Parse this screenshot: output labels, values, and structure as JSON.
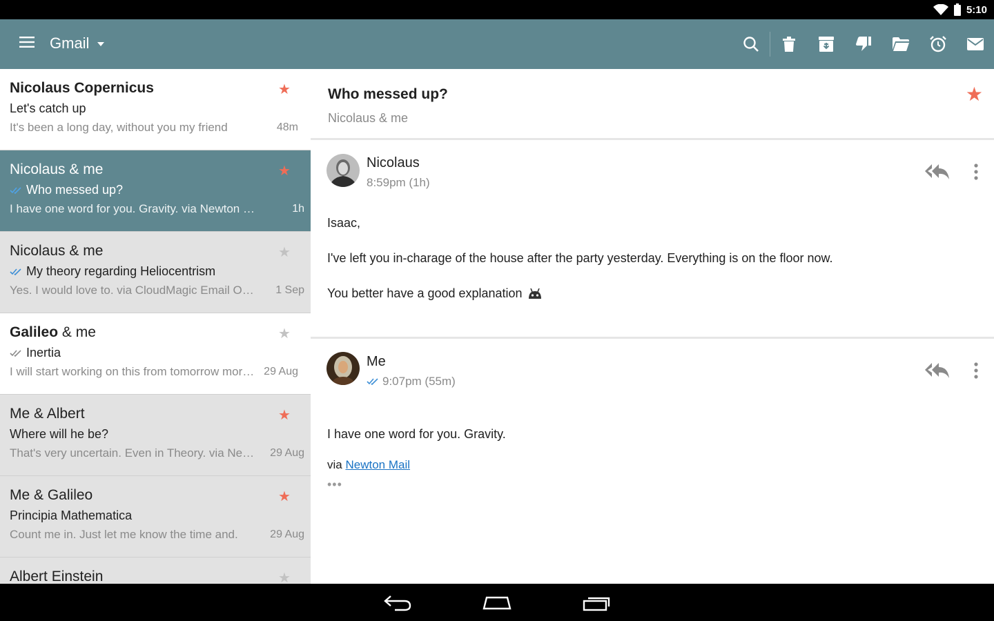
{
  "status_bar": {
    "time": "5:10"
  },
  "app_bar": {
    "account": "Gmail",
    "actions": [
      "search-icon",
      "trash-icon",
      "archive-icon",
      "spam-icon",
      "move-to-folder-icon",
      "snooze-icon",
      "mark-unread-icon"
    ]
  },
  "threads": [
    {
      "sender_bold": "Nicolaus Copernicus",
      "sender_rest": "",
      "subject": "Let's catch up",
      "preview": "It's been a long day, without you my friend",
      "time": "48m",
      "starred": true,
      "state": "unread",
      "check": "none"
    },
    {
      "sender_bold": "",
      "sender_rest": "Nicolaus & me",
      "subject": "Who messed up?",
      "preview": "I have one word for you. Gravity. via Newton Mail",
      "time": "1h",
      "starred": true,
      "state": "selected",
      "check": "blue"
    },
    {
      "sender_bold": "",
      "sender_rest": "Nicolaus & me",
      "subject": "My theory regarding Heliocentrism",
      "preview": "Yes. I would love to. via CloudMagic Email On...",
      "time": "1 Sep",
      "starred": false,
      "state": "read",
      "check": "blue"
    },
    {
      "sender_bold": "Galileo",
      "sender_rest": " & me",
      "subject": "Inertia",
      "preview": "I will start working on this from tomorrow morning",
      "time": "29 Aug",
      "starred": false,
      "state": "unread",
      "check": "grey"
    },
    {
      "sender_bold": "",
      "sender_rest": "Me & Albert",
      "subject": "Where will he be?",
      "preview": "That's very uncertain. Even in Theory. via Newton",
      "time": "29 Aug",
      "starred": true,
      "state": "read",
      "check": "none"
    },
    {
      "sender_bold": "",
      "sender_rest": "Me & Galileo",
      "subject": "Principia Mathematica",
      "preview": "Count me in. Just let me know the time and.",
      "time": "29 Aug",
      "starred": true,
      "state": "read",
      "check": "none"
    },
    {
      "sender_bold": "",
      "sender_rest": "Albert Einstein",
      "subject": "",
      "preview": "",
      "time": "",
      "starred": false,
      "state": "read",
      "check": "none"
    }
  ],
  "conversation": {
    "subject": "Who messed up?",
    "participants": "Nicolaus & me",
    "messages": [
      {
        "from": "Nicolaus",
        "time": "8:59pm (1h)",
        "body": [
          "Isaac,",
          "I've left you in-charage of the house after the party yesterday. Everything is on the floor now.",
          "You better have a good explanation"
        ]
      },
      {
        "from": "Me",
        "time": "9:07pm (55m)",
        "body": [
          "I have one word for you. Gravity."
        ],
        "via_label": "via",
        "via_link": "Newton Mail",
        "ellipsis": "•••"
      }
    ]
  },
  "colors": {
    "appbar": "#5f8790",
    "star": "#ef6d57",
    "link": "#1a73c4"
  }
}
